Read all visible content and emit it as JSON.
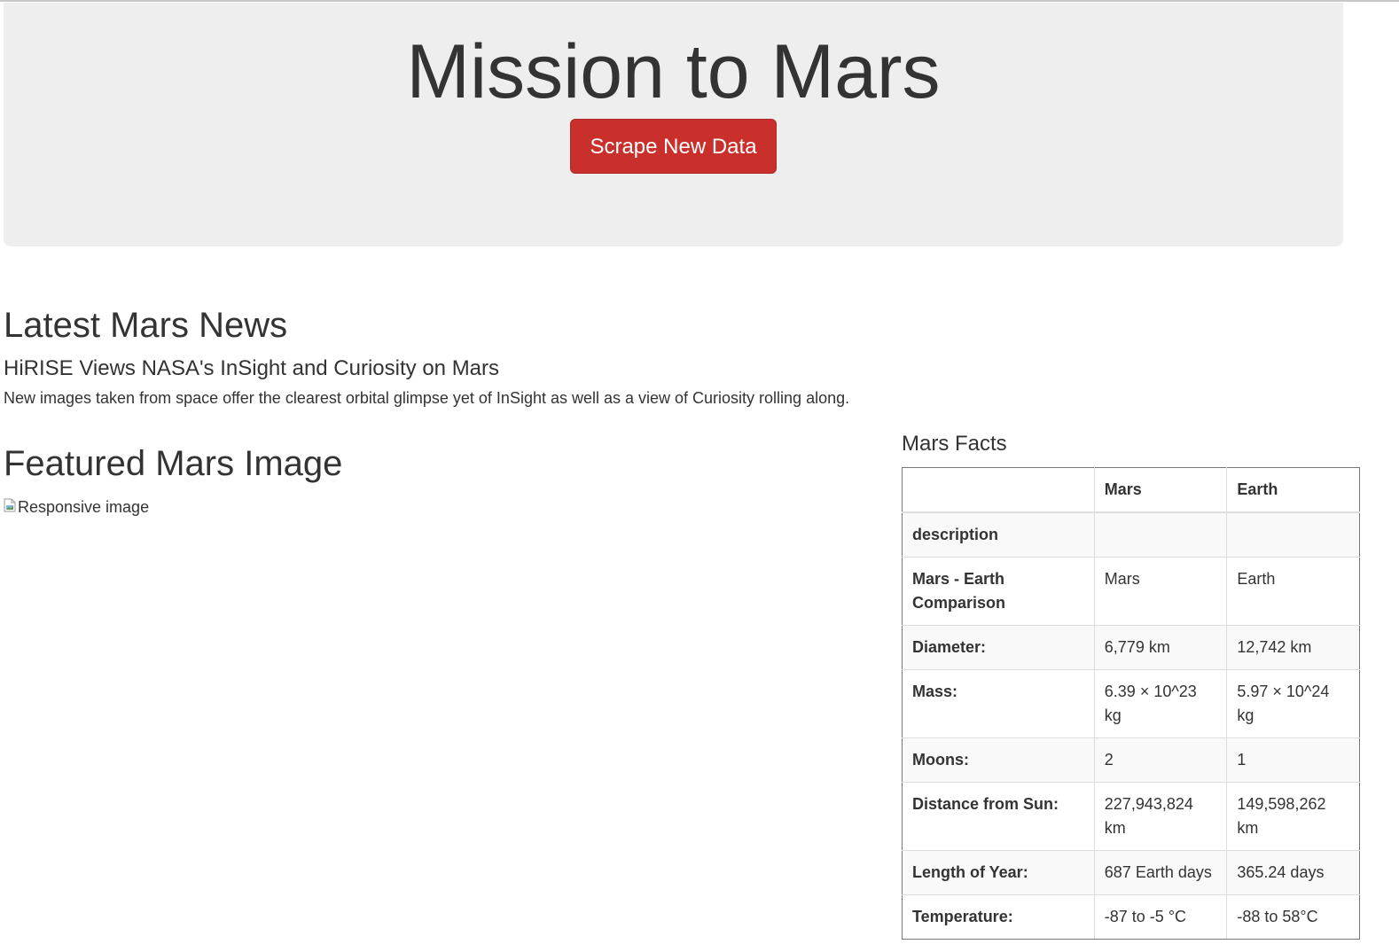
{
  "header": {
    "title": "Mission to Mars",
    "scrape_button_label": "Scrape New Data"
  },
  "news": {
    "section_title": "Latest Mars News",
    "headline": "HiRISE Views NASA's InSight and Curiosity on Mars",
    "teaser": "New images taken from space offer the clearest orbital glimpse yet of InSight as well as a view of Curiosity rolling along."
  },
  "featured": {
    "section_title": "Featured Mars Image",
    "image_alt": "Responsive image"
  },
  "facts": {
    "title": "Mars Facts",
    "columns": [
      "",
      "Mars",
      "Earth"
    ],
    "rows": [
      {
        "label": "description",
        "mars": "",
        "earth": ""
      },
      {
        "label": "Mars - Earth Comparison",
        "mars": "Mars",
        "earth": "Earth"
      },
      {
        "label": "Diameter:",
        "mars": "6,779 km",
        "earth": "12,742 km"
      },
      {
        "label": "Mass:",
        "mars": "6.39 × 10^23 kg",
        "earth": "5.97 × 10^24 kg"
      },
      {
        "label": "Moons:",
        "mars": "2",
        "earth": "1"
      },
      {
        "label": "Distance from Sun:",
        "mars": "227,943,824 km",
        "earth": "149,598,262 km"
      },
      {
        "label": "Length of Year:",
        "mars": "687 Earth days",
        "earth": "365.24 days"
      },
      {
        "label": "Temperature:",
        "mars": "-87 to -5 °C",
        "earth": "-88 to 58°C"
      }
    ]
  }
}
